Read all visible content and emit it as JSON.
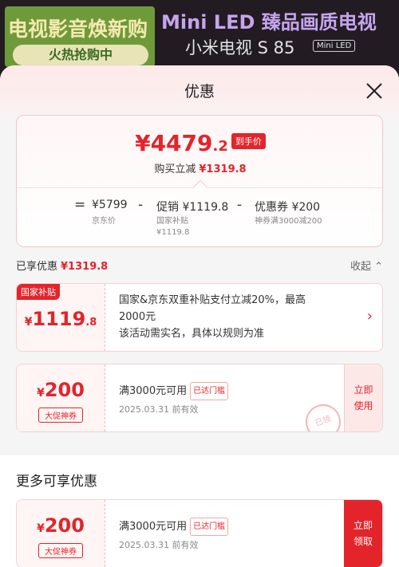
{
  "banner": {
    "left_title": "电视影音焕新购",
    "left_button": "火热抢购中",
    "right_title": "Mini LED 臻品画质电视",
    "right_model": "小米电视 S 85",
    "right_tag": "Mini LED"
  },
  "sheet": {
    "title": "优惠",
    "close_icon": "close-icon"
  },
  "price": {
    "currency": "¥",
    "integer": "4479",
    "decimal": ".2",
    "tag": "到手价",
    "save_label": "购买立减",
    "save_amount": "¥1319.8"
  },
  "formula": {
    "eq": "=",
    "minus": "-",
    "jd_price": "¥5799",
    "jd_price_label": "京东价",
    "promo": "促销 ¥1119.8",
    "promo_label1": "国家补贴",
    "promo_label2": "¥1119.8",
    "coupon": "优惠券 ¥200",
    "coupon_label": "神券满3000减200"
  },
  "enjoyed": {
    "label": "已享优惠",
    "amount": "¥1319.8",
    "collapse": "收起",
    "collapse_icon": "chevron-up-icon"
  },
  "subsidy": {
    "badge": "国家补贴",
    "currency": "¥",
    "amount": "1119",
    "decimal": ".8",
    "line1": "国家&京东双重补贴支付立减20%，最高",
    "line2": "2000元",
    "line3": "该活动需实名，具体以规则为准",
    "chevron_icon": "chevron-right-icon"
  },
  "coupon1": {
    "currency": "¥",
    "amount": "200",
    "tag": "大促神券",
    "condition": "满3000元可用",
    "reached": "已达门槛",
    "expiry": "2025.03.31 前有效",
    "action": "立即使用",
    "stamp": "已领"
  },
  "more_section": {
    "title": "更多可享优惠"
  },
  "coupon2": {
    "currency": "¥",
    "amount": "200",
    "tag": "大促神券",
    "condition": "满3000元可用",
    "reached": "已达门槛",
    "expiry": "2025.03.31 前有效",
    "action": "立即领取"
  },
  "colors": {
    "accent": "#e4242b",
    "sheet_bg": "#f5f5f5",
    "banner_green": "#6f9a3a",
    "banner_purple": "#c7a4ee"
  }
}
